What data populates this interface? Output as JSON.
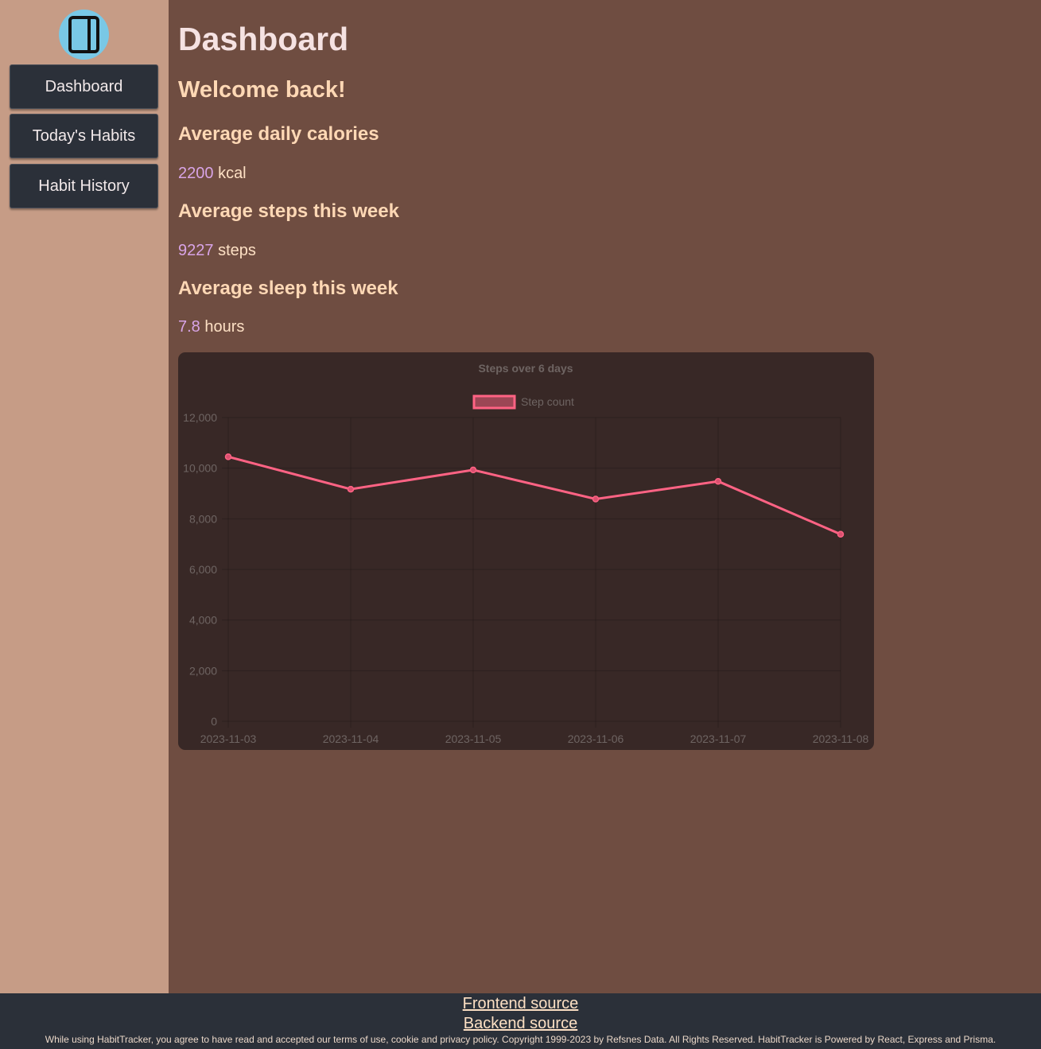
{
  "sidebar": {
    "logo_icon": "notebook-icon",
    "items": [
      {
        "label": "Dashboard"
      },
      {
        "label": "Today's Habits"
      },
      {
        "label": "Habit History"
      }
    ]
  },
  "main": {
    "title": "Dashboard",
    "welcome": "Welcome back!",
    "stats": [
      {
        "heading": "Average daily calories",
        "value": "2200",
        "unit": "kcal"
      },
      {
        "heading": "Average steps this week",
        "value": "9227",
        "unit": "steps"
      },
      {
        "heading": "Average sleep this week",
        "value": "7.8",
        "unit": "hours"
      }
    ]
  },
  "chart_data": {
    "type": "line",
    "title": "Steps over 6 days",
    "legend_position": "top",
    "categories": [
      "2023-11-03",
      "2023-11-04",
      "2023-11-05",
      "2023-11-06",
      "2023-11-07",
      "2023-11-08"
    ],
    "series": [
      {
        "name": "Step count",
        "values": [
          10450,
          9170,
          9930,
          8780,
          9480,
          7390
        ],
        "color": "#ff6384"
      }
    ],
    "ylim": [
      0,
      12000
    ],
    "yticks": [
      "0",
      "2,000",
      "4,000",
      "6,000",
      "8,000",
      "10,000",
      "12,000"
    ],
    "grid": true
  },
  "footer": {
    "frontend_link": "Frontend source",
    "backend_link": "Backend source",
    "legal": "While using HabitTracker, you agree to have read and accepted our terms of use, cookie and privacy policy. Copyright 1999-2023 by Refsnes Data. All Rights Reserved. HabitTracker is Powered by React, Express and Prisma."
  },
  "colors": {
    "sidebar_bg": "#c69c86",
    "main_bg": "#6f4d41",
    "nav_button_bg": "#2b3039",
    "chart_bg": "#382826",
    "accent_number": "#d8a4e6",
    "line": "#ff6384"
  }
}
